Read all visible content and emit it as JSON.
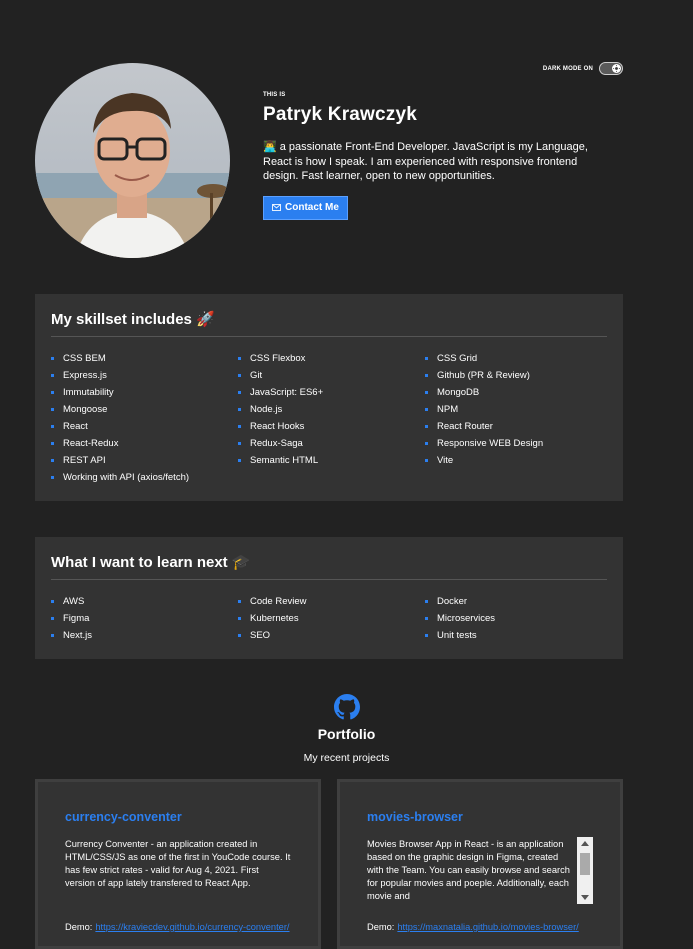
{
  "header": {
    "dark_mode_label": "DARK MODE ON",
    "this_is": "THIS IS",
    "name": "Patryk Krawczyk",
    "description": "👨‍💻 a passionate Front-End Developer. JavaScript is my Language, React is how I speak. I am experienced with responsive frontend design. Fast learner, open to new opportunities.",
    "contact_label": "Contact Me"
  },
  "skills": {
    "title": "My skillset includes 🚀",
    "items": [
      "CSS BEM",
      "CSS Flexbox",
      "CSS Grid",
      "Express.js",
      "Git",
      "Github (PR & Review)",
      "Immutability",
      "JavaScript: ES6+",
      "MongoDB",
      "Mongoose",
      "Node.js",
      "NPM",
      "React",
      "React Hooks",
      "React Router",
      "React-Redux",
      "Redux-Saga",
      "Responsive WEB Design",
      "REST API",
      "Semantic HTML",
      "Vite",
      "Working with API (axios/fetch)"
    ]
  },
  "learn": {
    "title": "What I want to learn next 🎓",
    "items": [
      "AWS",
      "Code Review",
      "Docker",
      "Figma",
      "Kubernetes",
      "Microservices",
      "Next.js",
      "SEO",
      "Unit tests"
    ]
  },
  "portfolio": {
    "title": "Portfolio",
    "subtitle": "My recent projects"
  },
  "projects": [
    {
      "title": "currency-conventer",
      "description": "Currency Conventer - an application created in HTML/CSS/JS as one of the first in YouCode course. It has few strict rates - valid for Aug 4, 2021. First version of app lately transfered to React App.",
      "demo_label": "Demo:",
      "demo_link": "https://kraviecdev.github.io/currency-conventer/"
    },
    {
      "title": "movies-browser",
      "description": "Movies Browser App in React - is an application based on the graphic design in Figma, created with the Team. You can easily browse and search for popular movies and poeple. Additionally, each movie and",
      "demo_label": "Demo:",
      "demo_link": "https://maxnatalia.github.io/movies-browser/"
    }
  ],
  "colors": {
    "background": "#222222",
    "panel": "#333333",
    "accent": "#2b7ff0"
  }
}
